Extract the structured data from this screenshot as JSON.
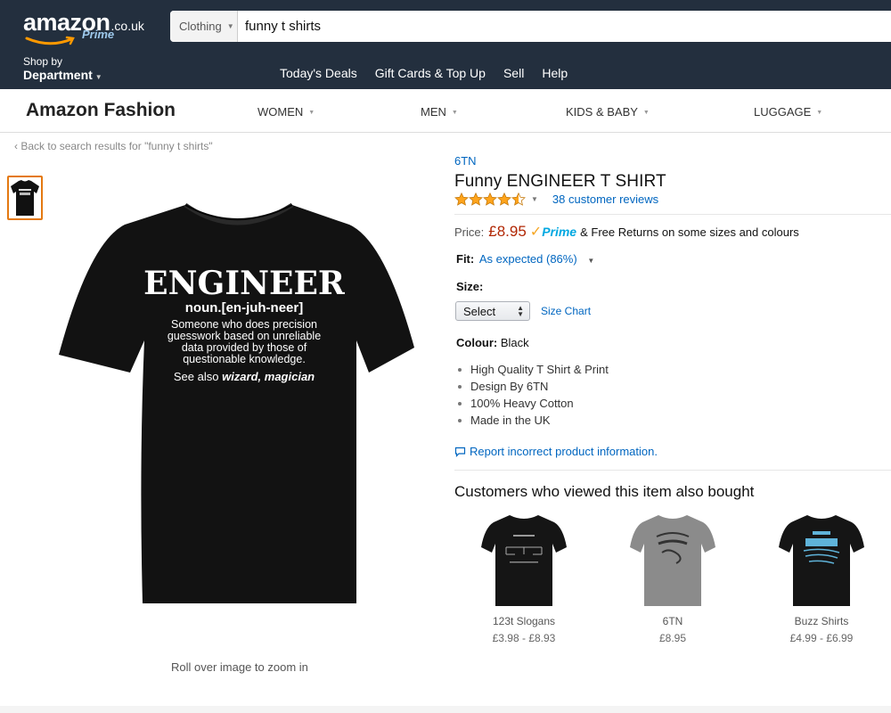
{
  "header": {
    "logo_text": "amazon",
    "logo_domain": ".co.uk",
    "logo_prime": "Prime",
    "search": {
      "category": "Clothing",
      "query": "funny t shirts"
    },
    "shop_by_small": "Shop by",
    "shop_by_big": "Department",
    "nav_links": [
      "Today's Deals",
      "Gift Cards & Top Up",
      "Sell",
      "Help"
    ]
  },
  "fashion": {
    "title": "Amazon Fashion",
    "nav": [
      "WOMEN",
      "MEN",
      "KIDS & BABY",
      "LUGGAGE"
    ]
  },
  "back_link": "Back to search results for \"funny t shirts\"",
  "image_caption": "Roll over image to zoom in",
  "shirt_print": {
    "headline": "ENGINEER",
    "pronunciation": "noun.[en-juh-neer]",
    "definition_lines": [
      "Someone who does precision",
      "guesswork based on unreliable",
      "data provided by those of",
      "questionable knowledge."
    ],
    "see_also_prefix": "See also ",
    "see_also_terms": "wizard, magician"
  },
  "product": {
    "brand": "6TN",
    "title": "Funny ENGINEER T SHIRT",
    "rating": 4.5,
    "reviews": "38 customer reviews",
    "price_label": "Price:",
    "price": "£8.95",
    "prime": "Prime",
    "returns": "& Free Returns on some sizes and colours",
    "fit_label": "Fit:",
    "fit_value": "As expected (86%)",
    "size_label": "Size:",
    "size_selected": "Select",
    "size_chart": "Size Chart",
    "colour_label": "Colour:",
    "colour_value": "Black",
    "bullets": [
      "High Quality T Shirt & Print",
      "Design By 6TN",
      "100% Heavy Cotton",
      "Made in the UK"
    ],
    "report_link": "Report incorrect product information."
  },
  "also_bought": {
    "heading": "Customers who viewed this item also bought",
    "items": [
      {
        "name": "123t Slogans",
        "price": "£3.98 - £8.93"
      },
      {
        "name": "6TN",
        "price": "£8.95"
      },
      {
        "name": "Buzz Shirts",
        "price": "£4.99 - £6.99"
      }
    ]
  },
  "colors": {
    "header_bg": "#232f3e",
    "link": "#0066c0",
    "price": "#b12704",
    "star": "#ffa41c",
    "prime_blue": "#00a8e1",
    "thumb_border": "#e47911"
  }
}
